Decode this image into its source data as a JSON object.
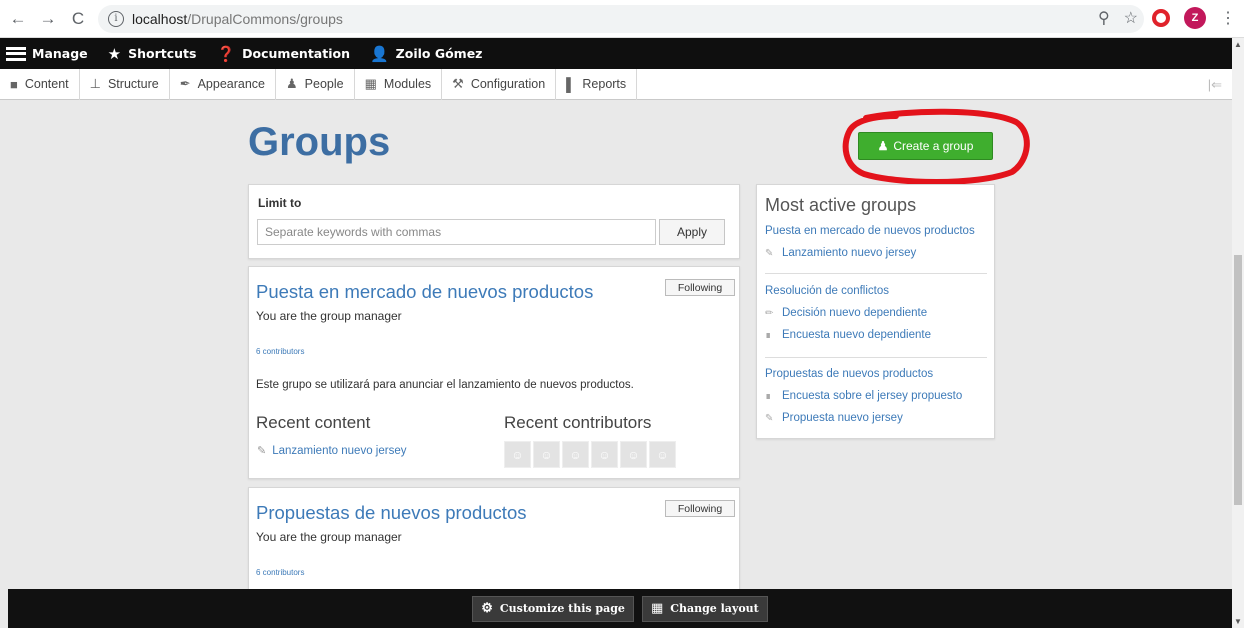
{
  "browser": {
    "back": "←",
    "forward": "→",
    "reload": "C",
    "url_host": "localhost",
    "url_path": "/DrupalCommons/groups",
    "profile_initial": "Z"
  },
  "toolbar": {
    "manage": "Manage",
    "shortcuts": "Shortcuts",
    "documentation": "Documentation",
    "user": "Zoilo Gómez"
  },
  "tray": {
    "items": [
      "Content",
      "Structure",
      "Appearance",
      "People",
      "Modules",
      "Configuration",
      "Reports"
    ]
  },
  "page": {
    "title": "Groups",
    "create_button": "Create a group"
  },
  "filter": {
    "label": "Limit to",
    "placeholder": "Separate keywords with commas",
    "apply": "Apply"
  },
  "groups": [
    {
      "title": "Puesta en mercado de nuevos productos",
      "follow": "Following",
      "role": "You are the group manager",
      "contributors": "6 contributors",
      "description": "Este grupo se utilizará para anunciar el lanzamiento de nuevos productos.",
      "recent_content_heading": "Recent content",
      "recent_contributors_heading": "Recent contributors",
      "recent_item": "Lanzamiento nuevo jersey"
    },
    {
      "title": "Propuestas de nuevos productos",
      "follow": "Following",
      "role": "You are the group manager",
      "contributors": "6 contributors"
    }
  ],
  "most_active": {
    "title": "Most active groups",
    "groups": [
      {
        "title": "Puesta en mercado de nuevos productos",
        "items": [
          "Lanzamiento nuevo jersey"
        ]
      },
      {
        "title": "Resolución de conflictos",
        "items": [
          "Decisión nuevo dependiente",
          "Encuesta nuevo dependiente"
        ]
      },
      {
        "title": "Propuestas de nuevos productos",
        "items": [
          "Encuesta sobre el jersey propuesto",
          "Propuesta nuevo jersey"
        ]
      }
    ]
  },
  "bottom_bar": {
    "customize": "Customize this page",
    "change_layout": "Change layout"
  }
}
